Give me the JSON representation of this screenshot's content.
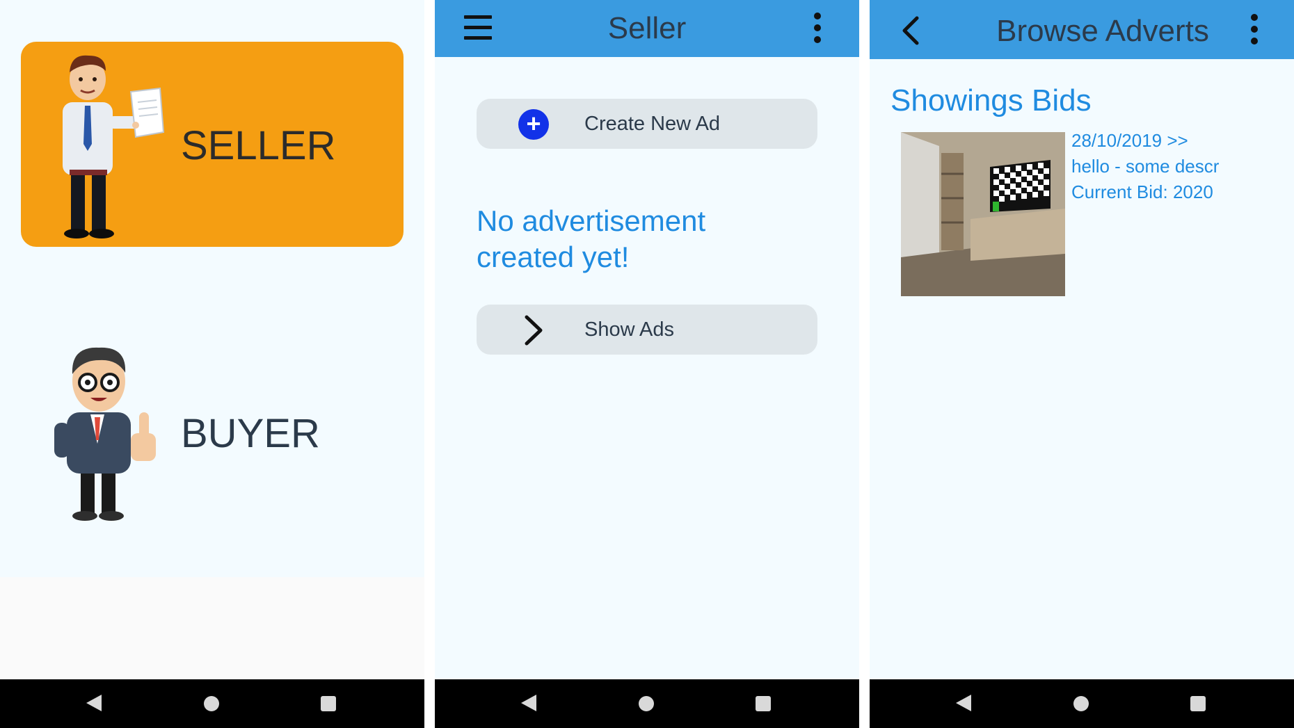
{
  "screen1": {
    "seller_label": "SELLER",
    "buyer_label": "BUYER"
  },
  "screen2": {
    "title": "Seller",
    "create_btn": "Create New Ad",
    "empty_message": "No advertisement created yet!",
    "show_btn": "Show Ads"
  },
  "screen3": {
    "title": "Browse Adverts",
    "section_title": "Showings Bids",
    "item": {
      "date": "28/10/2019 >>",
      "description": "hello - some descr",
      "bid": "Current Bid: 2020"
    }
  },
  "colors": {
    "appbar": "#3a9be0",
    "seller_card": "#f59e12",
    "accent_text": "#1f8be0",
    "plus_button": "#1232e8",
    "navbar": "#000000"
  },
  "icons": [
    "hamburger-icon",
    "more-vert-icon",
    "back-arrow-icon",
    "plus-circle-icon",
    "chevron-right-icon",
    "nav-back-icon",
    "nav-home-icon",
    "nav-recents-icon"
  ]
}
